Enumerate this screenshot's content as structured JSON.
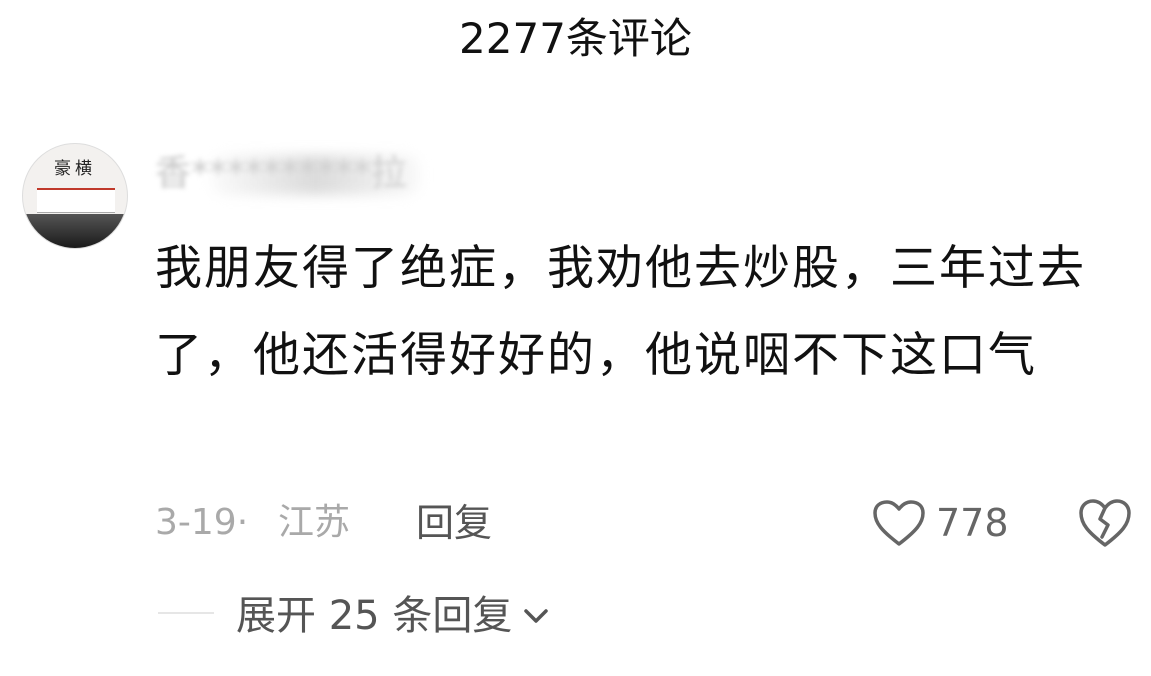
{
  "header": {
    "title": "2277条评论"
  },
  "comment": {
    "avatar_caption": "豪横",
    "username": "香**********拉",
    "text": "我朋友得了绝症，我劝他去炒股，三年过去了，他还活得好好的，他说咽不下这口气",
    "date": "3-19·",
    "location": "江苏",
    "reply_label": "回复",
    "like_count": "778"
  },
  "replies": {
    "expand_label": "展开 25 条回复"
  },
  "icons": {
    "like": "heart-outline-icon",
    "dislike": "broken-heart-icon",
    "expand": "chevron-down-icon"
  },
  "colors": {
    "text_primary": "#111111",
    "text_secondary": "#a9a9a9",
    "icon_gray": "#666666"
  }
}
